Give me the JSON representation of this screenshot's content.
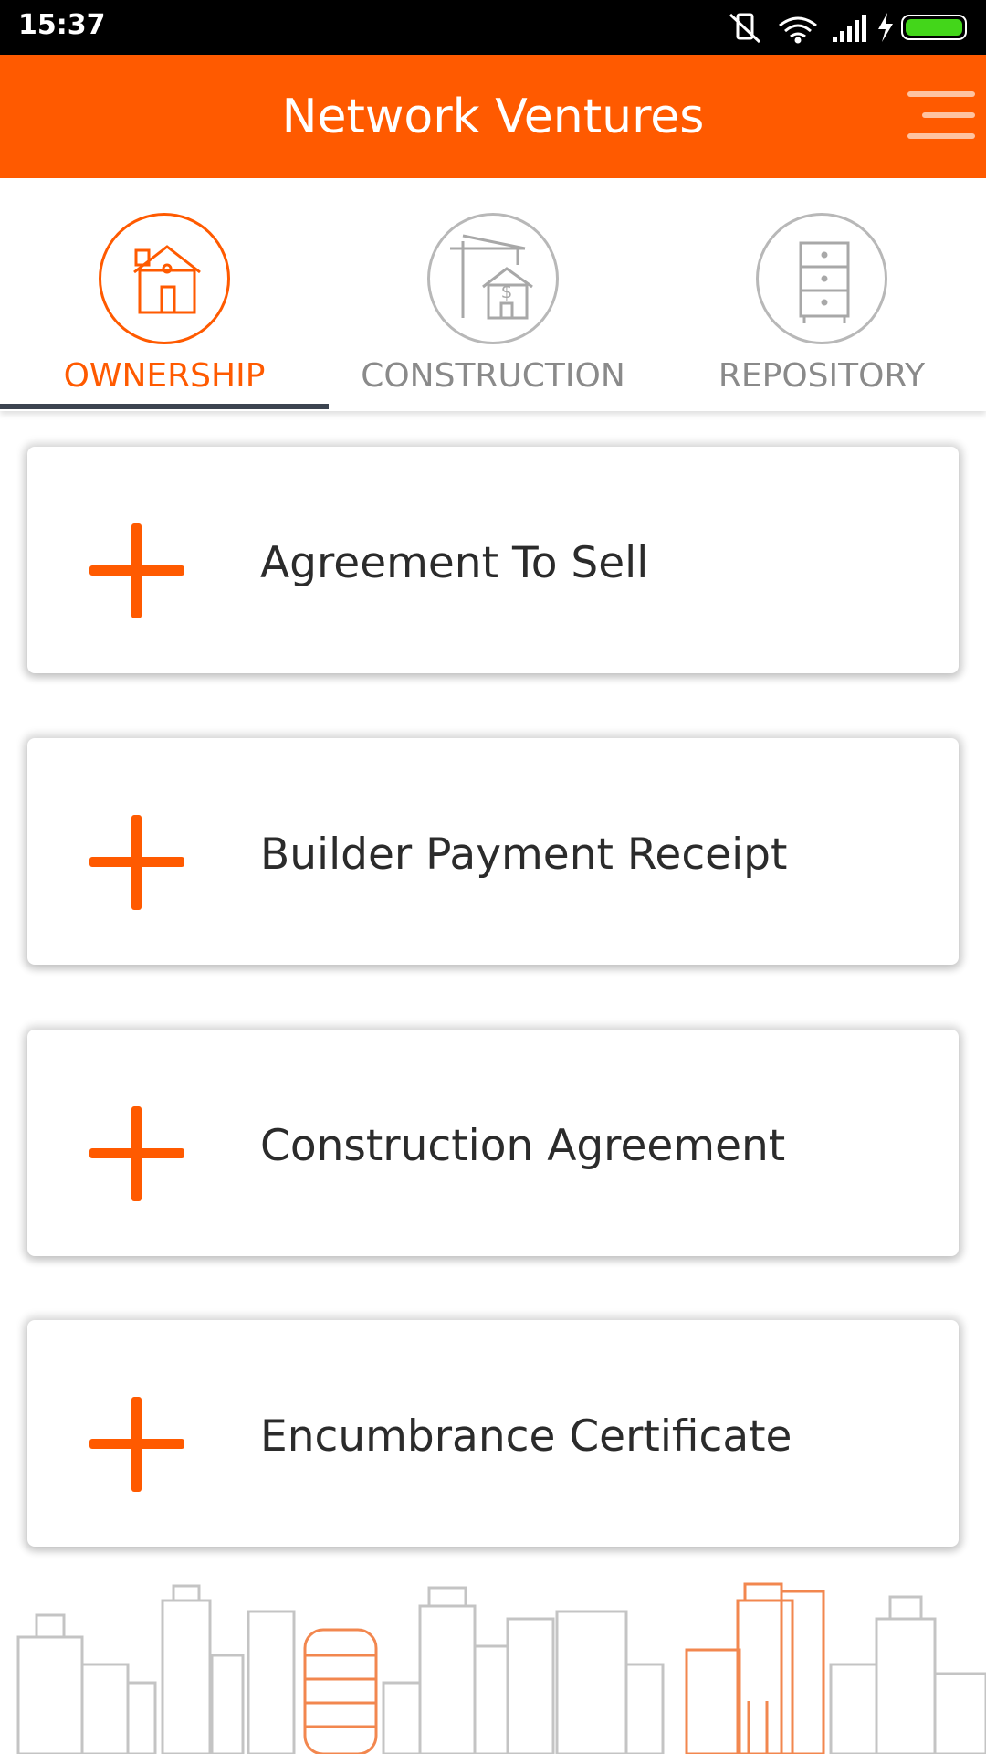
{
  "status_bar": {
    "time": "15:37"
  },
  "app_bar": {
    "title": "Network Ventures"
  },
  "tabs": [
    {
      "label": "OWNERSHIP",
      "icon": "house-icon",
      "active": true
    },
    {
      "label": "CONSTRUCTION",
      "icon": "crane-house-icon",
      "active": false
    },
    {
      "label": "REPOSITORY",
      "icon": "cabinet-icon",
      "active": false
    }
  ],
  "documents": [
    {
      "label": "Agreement To Sell",
      "icon": "plus-icon"
    },
    {
      "label": "Builder Payment Receipt",
      "icon": "plus-icon"
    },
    {
      "label": "Construction Agreement",
      "icon": "plus-icon"
    },
    {
      "label": "Encumbrance Certificate",
      "icon": "plus-icon"
    }
  ],
  "colors": {
    "accent": "#ff5a00",
    "inactive": "#8a8a8a",
    "indicator": "#3c4450"
  }
}
